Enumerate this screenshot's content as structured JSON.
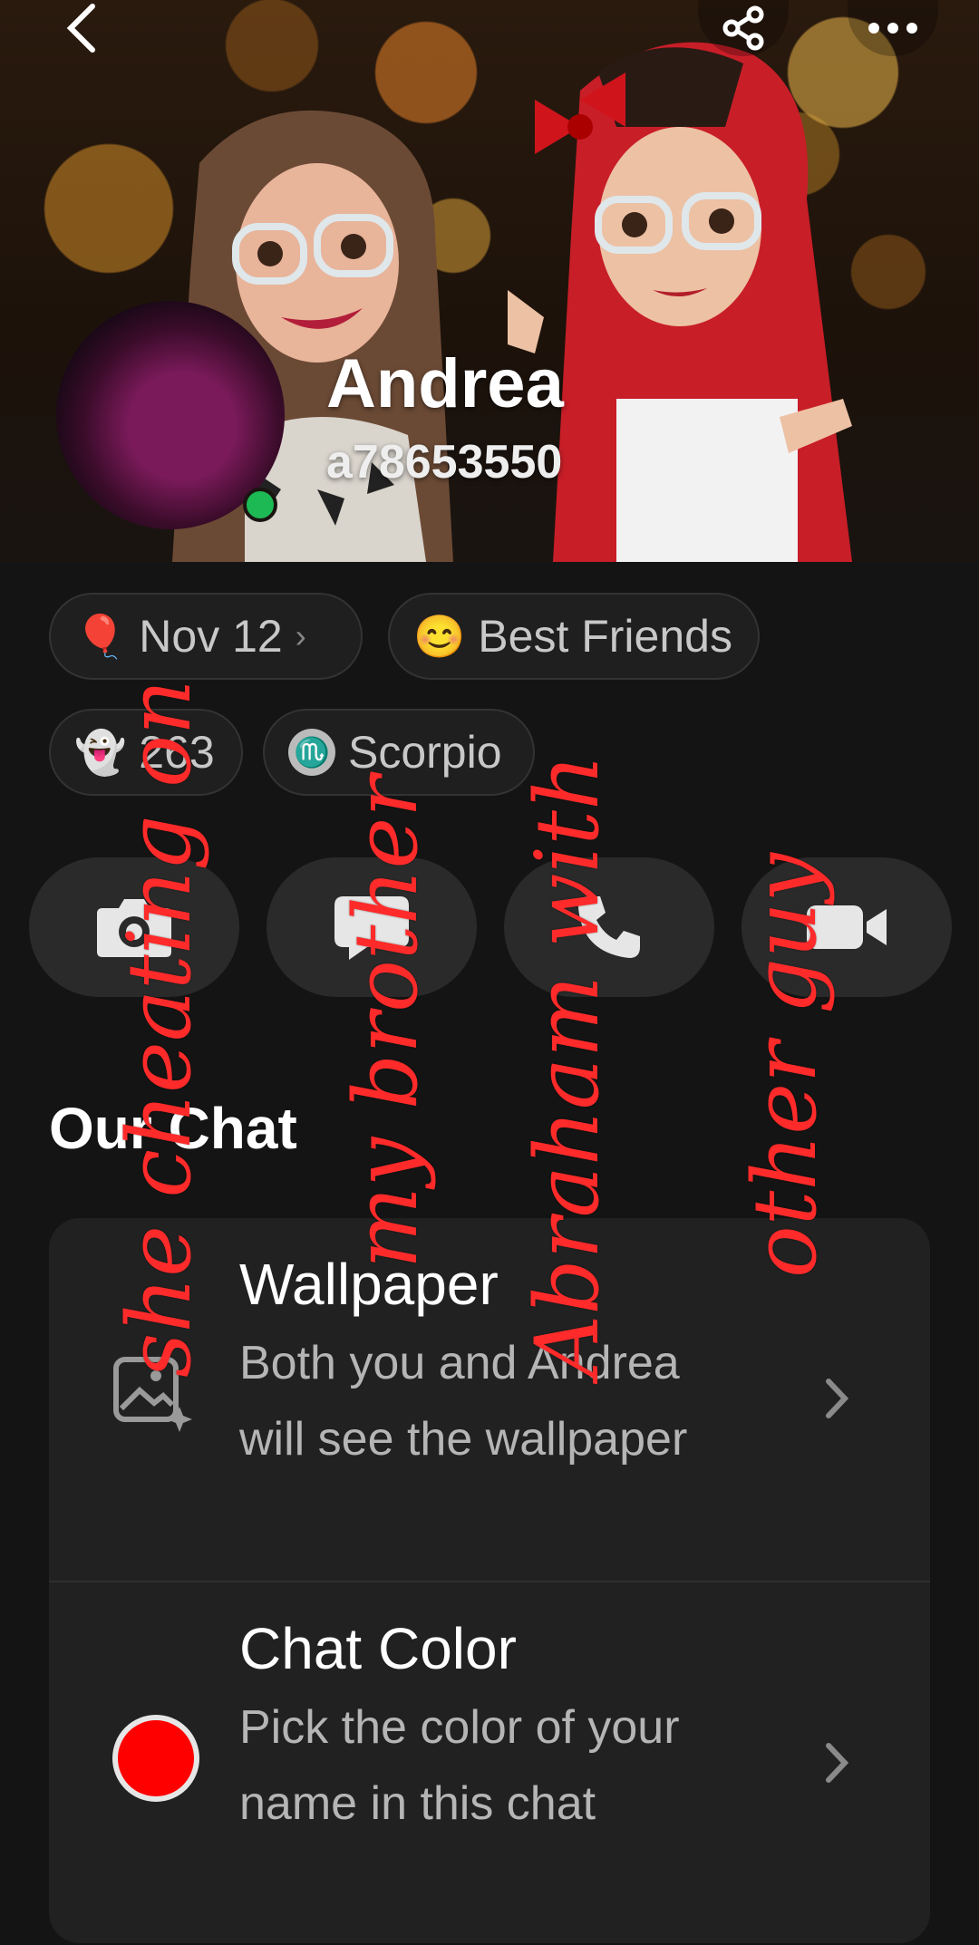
{
  "profile": {
    "name": "Andrea",
    "username": "a78653550"
  },
  "chips": {
    "birthday": {
      "icon": "balloon-icon",
      "label": "Nov 12",
      "chevron": "›"
    },
    "friendship": {
      "icon": "smiling-emoji-icon",
      "label": "Best Friends"
    },
    "score": {
      "icon": "ghost-icon",
      "label": "263"
    },
    "zodiac": {
      "icon": "scorpio-icon",
      "label": "Scorpio"
    }
  },
  "actions": [
    "camera-icon",
    "chat-bubble-icon",
    "phone-icon",
    "video-icon"
  ],
  "section": {
    "title": "Our Chat"
  },
  "settings": [
    {
      "title": "Wallpaper",
      "subtitle": "Both you and Andrea will see the wallpaper",
      "icon": "wallpaper-icon"
    },
    {
      "title": "Chat Color",
      "subtitle": "Pick the color of your name in this chat",
      "icon": "color-swatch-icon",
      "color": "#ff0000"
    }
  ],
  "overlay_text": [
    "she cheating on",
    "my brother",
    "Abraham with",
    "other guy"
  ],
  "colors": {
    "overlay": "#ff2a2a",
    "online": "#1db954",
    "background": "#141414",
    "card": "#212121"
  }
}
